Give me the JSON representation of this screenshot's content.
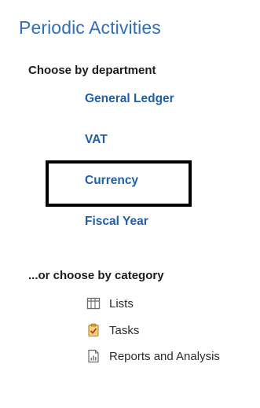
{
  "page": {
    "title": "Periodic Activities"
  },
  "department_section": {
    "heading": "Choose by department",
    "links": [
      {
        "label": "General Ledger"
      },
      {
        "label": "VAT"
      },
      {
        "label": "Currency"
      },
      {
        "label": "Fiscal Year"
      }
    ]
  },
  "category_section": {
    "heading": "...or choose by category",
    "items": [
      {
        "label": "Lists",
        "icon": "list-icon"
      },
      {
        "label": "Tasks",
        "icon": "tasks-icon"
      },
      {
        "label": "Reports and Analysis",
        "icon": "report-icon"
      }
    ]
  },
  "colors": {
    "title": "#2f6fb6",
    "link": "#1f5fa8",
    "highlight_border": "#000000"
  }
}
